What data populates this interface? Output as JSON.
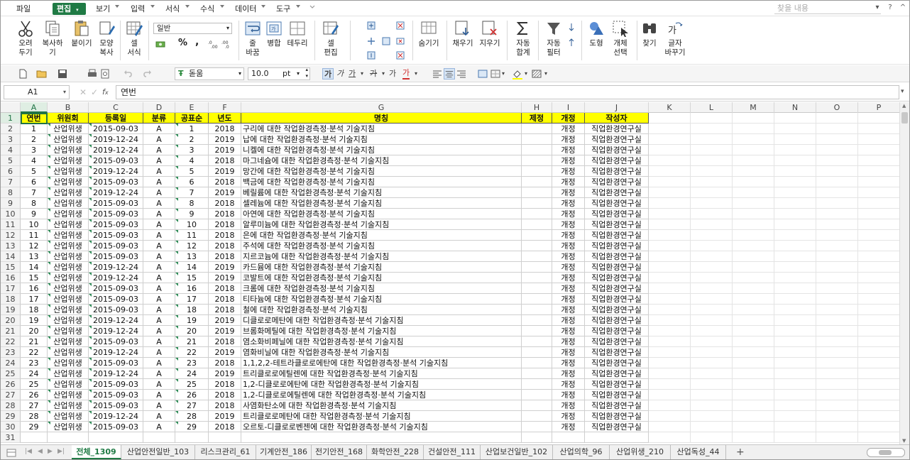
{
  "menu": {
    "items": [
      "파일",
      "편집",
      "보기",
      "입력",
      "서식",
      "수식",
      "데이터",
      "도구"
    ],
    "active": "편집",
    "search_placeholder": "찾을 내용"
  },
  "ribbon": {
    "cut": "오려\n두기",
    "copy": "복사하기",
    "paste": "붙이기",
    "format_copy": "모양\n복사",
    "cell_format": "셀\n서식",
    "number_format": "일반",
    "percent": "%",
    "comma": ",",
    "line_wrap": "줄\n바꿈",
    "merge": "병합",
    "border": "테두리",
    "cell_edit": "셀\n편집",
    "hide": "숨기기",
    "fill": "채우기",
    "clear": "지우기",
    "autosum": "자동\n합계",
    "autofilter": "자동\n필터",
    "shapes": "도형",
    "object_select": "개체\n선택",
    "find": "찾기",
    "replace": "글자\n바꾸기"
  },
  "toolbar": {
    "font_name": "돋움",
    "font_size": "10.0",
    "font_unit": "pt",
    "bold": "가",
    "italic": "가",
    "underline": "가",
    "strike": "가",
    "sup": "가",
    "color": "가"
  },
  "formula_bar": {
    "cell_ref": "A1",
    "value": "연번"
  },
  "columns": [
    "A",
    "B",
    "C",
    "D",
    "E",
    "F",
    "G",
    "H",
    "I",
    "J",
    "K",
    "L",
    "M",
    "N",
    "O",
    "P"
  ],
  "table": {
    "headers": [
      "연번",
      "위원회",
      "등록일",
      "분류",
      "공표순",
      "년도",
      "명칭",
      "제정",
      "개정",
      "작성자"
    ],
    "rows": [
      [
        "1",
        "산업위생",
        "2015-09-03",
        "A",
        "1",
        "2018",
        "구리에 대한 작업환경측정·분석 기술지침",
        "",
        "개정",
        "직업환경연구실"
      ],
      [
        "2",
        "산업위생",
        "2019-12-24",
        "A",
        "2",
        "2019",
        "납에 대한 작업환경측정·분석 기술지침",
        "",
        "개정",
        "직업환경연구실"
      ],
      [
        "3",
        "산업위생",
        "2019-12-24",
        "A",
        "3",
        "2019",
        "니켈에 대한 작업환경측정·분석 기술지침",
        "",
        "개정",
        "직업환경연구실"
      ],
      [
        "4",
        "산업위생",
        "2015-09-03",
        "A",
        "4",
        "2018",
        "마그네슘에 대한 작업환경측정·분석 기술지침",
        "",
        "개정",
        "직업환경연구실"
      ],
      [
        "5",
        "산업위생",
        "2019-12-24",
        "A",
        "5",
        "2019",
        "망간에 대한 작업환경측정·분석 기술지침",
        "",
        "개정",
        "직업환경연구실"
      ],
      [
        "6",
        "산업위생",
        "2015-09-03",
        "A",
        "6",
        "2018",
        "백금에 대한 작업환경측정·분석 기술지침",
        "",
        "개정",
        "직업환경연구실"
      ],
      [
        "7",
        "산업위생",
        "2019-12-24",
        "A",
        "7",
        "2019",
        "베릴륨에 대한 작업환경측정·분석 기술지침",
        "",
        "개정",
        "직업환경연구실"
      ],
      [
        "8",
        "산업위생",
        "2015-09-03",
        "A",
        "8",
        "2018",
        "셀레늄에 대한 작업환경측정·분석 기술지침",
        "",
        "개정",
        "직업환경연구실"
      ],
      [
        "9",
        "산업위생",
        "2015-09-03",
        "A",
        "9",
        "2018",
        "아연에 대한 작업환경측정·분석 기술지침",
        "",
        "개정",
        "직업환경연구실"
      ],
      [
        "10",
        "산업위생",
        "2015-09-03",
        "A",
        "10",
        "2018",
        "알루미늄에 대한 작업환경측정·분석 기술지침",
        "",
        "개정",
        "직업환경연구실"
      ],
      [
        "11",
        "산업위생",
        "2015-09-03",
        "A",
        "11",
        "2018",
        "은에 대한 작업환경측정·분석 기술지침",
        "",
        "개정",
        "직업환경연구실"
      ],
      [
        "12",
        "산업위생",
        "2015-09-03",
        "A",
        "12",
        "2018",
        "주석에 대한 작업환경측정·분석 기술지침",
        "",
        "개정",
        "직업환경연구실"
      ],
      [
        "13",
        "산업위생",
        "2015-09-03",
        "A",
        "13",
        "2018",
        "지르코늄에 대한 작업환경측정·분석 기술지침",
        "",
        "개정",
        "직업환경연구실"
      ],
      [
        "14",
        "산업위생",
        "2019-12-24",
        "A",
        "14",
        "2019",
        "카드뮴에 대한 작업환경측정·분석 기술지침",
        "",
        "개정",
        "직업환경연구실"
      ],
      [
        "15",
        "산업위생",
        "2019-12-24",
        "A",
        "15",
        "2019",
        "코발트에 대한 작업환경측정·분석 기술지침",
        "",
        "개정",
        "직업환경연구실"
      ],
      [
        "16",
        "산업위생",
        "2015-09-03",
        "A",
        "16",
        "2018",
        "크롬에 대한 작업환경측정·분석 기술지침",
        "",
        "개정",
        "직업환경연구실"
      ],
      [
        "17",
        "산업위생",
        "2015-09-03",
        "A",
        "17",
        "2018",
        "티타늄에 대한 작업환경측정·분석 기술지침",
        "",
        "개정",
        "직업환경연구실"
      ],
      [
        "18",
        "산업위생",
        "2015-09-03",
        "A",
        "18",
        "2018",
        "철에 대한 작업환경측정·분석 기술지침",
        "",
        "개정",
        "직업환경연구실"
      ],
      [
        "19",
        "산업위생",
        "2019-12-24",
        "A",
        "19",
        "2019",
        "디클로로메탄에 대한 작업환경측정·분석 기술지침",
        "",
        "개정",
        "직업환경연구실"
      ],
      [
        "20",
        "산업위생",
        "2019-12-24",
        "A",
        "20",
        "2019",
        "브롬화메틸에 대한 작업환경측정·분석 기술지침",
        "",
        "개정",
        "직업환경연구실"
      ],
      [
        "21",
        "산업위생",
        "2015-09-03",
        "A",
        "21",
        "2018",
        "염소화비페닐에 대한 작업환경측정·분석 기술지침",
        "",
        "개정",
        "직업환경연구실"
      ],
      [
        "22",
        "산업위생",
        "2019-12-24",
        "A",
        "22",
        "2019",
        "염화비닐에 대한 작업환경측정·분석 기술지침",
        "",
        "개정",
        "직업환경연구실"
      ],
      [
        "23",
        "산업위생",
        "2015-09-03",
        "A",
        "23",
        "2018",
        "1,1,2,2-테트라클로로에탄에 대한 작업환경측정·분석 기술지침",
        "",
        "개정",
        "직업환경연구실"
      ],
      [
        "24",
        "산업위생",
        "2019-12-24",
        "A",
        "24",
        "2019",
        "트리클로로에틸렌에 대한 작업환경측정·분석 기술지침",
        "",
        "개정",
        "직업환경연구실"
      ],
      [
        "25",
        "산업위생",
        "2015-09-03",
        "A",
        "25",
        "2018",
        "1,2-디클로로에탄에 대한 작업환경측정·분석 기술지침",
        "",
        "개정",
        "직업환경연구실"
      ],
      [
        "26",
        "산업위생",
        "2015-09-03",
        "A",
        "26",
        "2018",
        "1,2-디클로로에틸렌에 대한 작업환경측정·분석 기술지침",
        "",
        "개정",
        "직업환경연구실"
      ],
      [
        "27",
        "산업위생",
        "2015-09-03",
        "A",
        "27",
        "2018",
        "사염화탄소에 대한 작업환경측정·분석 기술지침",
        "",
        "개정",
        "직업환경연구실"
      ],
      [
        "28",
        "산업위생",
        "2019-12-24",
        "A",
        "28",
        "2019",
        "트리클로로메탄에 대한 작업환경측정·분석 기술지침",
        "",
        "개정",
        "직업환경연구실"
      ],
      [
        "29",
        "산업위생",
        "2015-09-03",
        "A",
        "29",
        "2018",
        "오르토-디클로로벤젠에 대한 작업환경측정·분석 기술지침",
        "",
        "개정",
        "직업환경연구실"
      ]
    ]
  },
  "sheet_tabs": [
    "전체_1309",
    "산업안전일반_103",
    "리스크관리_61",
    "기계안전_186",
    "전기안전_168",
    "화학안전_228",
    "건설안전_111",
    "산업보건일반_102",
    "산업의학_96",
    "산업위생_210",
    "산업독성_44"
  ],
  "active_tab": "전체_1309",
  "colors": {
    "accent": "#1f7a44",
    "header_fill": "#ffff00"
  }
}
